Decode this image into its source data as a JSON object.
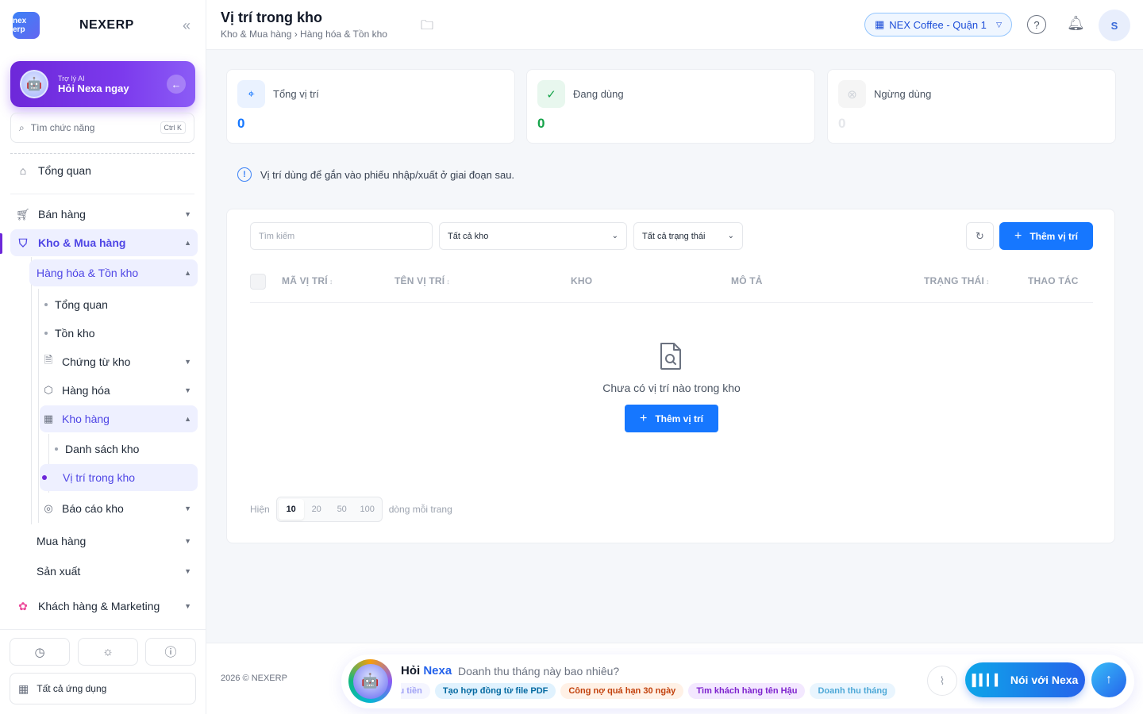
{
  "sidebar": {
    "logo_mark": "nex erp",
    "app_name": "NEXERP",
    "collapse_icon": "«",
    "ai": {
      "sub": "Trợ lý AI",
      "title": "Hỏi Nexa ngay"
    },
    "search": {
      "placeholder": "Tìm chức năng",
      "shortcut": "Ctrl K"
    },
    "nav": {
      "overview": "Tổng quan",
      "sales": "Bán hàng",
      "warehouse": "Kho & Mua hàng",
      "goods_inventory": "Hàng hóa & Tồn kho",
      "sub_overview": "Tổng quan",
      "stock": "Tồn kho",
      "stock_docs": "Chứng từ kho",
      "goods": "Hàng hóa",
      "warehouses": "Kho hàng",
      "warehouse_list": "Danh sách kho",
      "warehouse_locations": "Vị trí trong kho",
      "warehouse_reports": "Báo cáo kho",
      "purchasing": "Mua hàng",
      "production": "Sản xuất",
      "crm": "Khách hàng & Marketing"
    },
    "all_apps": "Tất cả ứng dụng"
  },
  "header": {
    "title": "Vị trí trong kho",
    "breadcrumb": "Kho & Mua hàng › Hàng hóa & Tồn kho",
    "branch": "NEX Coffee - Quận 1",
    "help": "?",
    "avatar_initial": "S"
  },
  "stats": [
    {
      "label": "Tổng vị trí",
      "value": "0",
      "color": "#1677ff"
    },
    {
      "label": "Đang dùng",
      "value": "0",
      "color": "#16a34a"
    },
    {
      "label": "Ngừng dùng",
      "value": "0",
      "color": "#d1d5db"
    }
  ],
  "info_text": "Vị trí dùng để gắn vào phiếu nhập/xuất ở giai đoạn sau.",
  "filters": {
    "search_placeholder": "Tìm kiếm",
    "warehouse": "Tất cả kho",
    "status": "Tất cả trạng thái",
    "add_label": "Thêm vị trí"
  },
  "table": {
    "columns": [
      "MÃ VỊ TRÍ",
      "TÊN VỊ TRÍ",
      "KHO",
      "MÔ TẢ",
      "TRẠNG THÁI",
      "THAO TÁC"
    ],
    "empty_text": "Chưa có vị trí nào trong kho",
    "empty_add": "Thêm vị trí"
  },
  "pager": {
    "prefix": "Hiện",
    "sizes": [
      "10",
      "20",
      "50",
      "100"
    ],
    "selected": "10",
    "suffix": "dòng mỗi trang"
  },
  "footer": {
    "copyright": "2026 © NEXERP",
    "ask_prefix": "Hỏi",
    "ask_brand": "Nexa",
    "question": "Doanh thu tháng này bao nhiêu?",
    "chips": [
      "ưa thu tiền",
      "Tạo hợp đồng từ file PDF",
      "Công nợ quá hạn 30 ngày",
      "Tìm khách hàng tên Hậu",
      "Doanh thu tháng"
    ],
    "talk_label": "Nói với Nexa"
  },
  "colors": {
    "primary": "#1677ff",
    "accent": "#6d28d9",
    "success": "#16a34a"
  }
}
